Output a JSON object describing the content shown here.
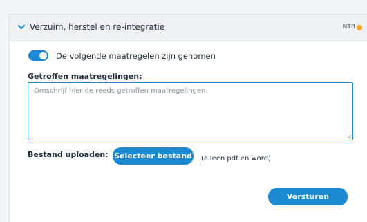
{
  "section": {
    "title": "Verzuim, herstel en re-integratie",
    "status": "NTB",
    "status_color": "#f5a623"
  },
  "measures_toggle": {
    "state": "on",
    "label": "De volgende maatregelen zijn genomen"
  },
  "measures": {
    "label": "Getroffen maatregelingen:",
    "value": "",
    "placeholder": "Omschrijf hier de reeds getroffen maatregelingen."
  },
  "upload": {
    "label": "Bestand uploaden:",
    "button_label": "Selecteer bestand",
    "hint": "(alleen pdf en word)"
  },
  "submit": {
    "label": "Versturen"
  },
  "colors": {
    "accent": "#1b8ad1",
    "header_bg": "#eef0f3"
  },
  "icons": {
    "collapse": "chevron-down-icon",
    "status": "status-dot-icon",
    "resize": "resize-handle-icon"
  }
}
